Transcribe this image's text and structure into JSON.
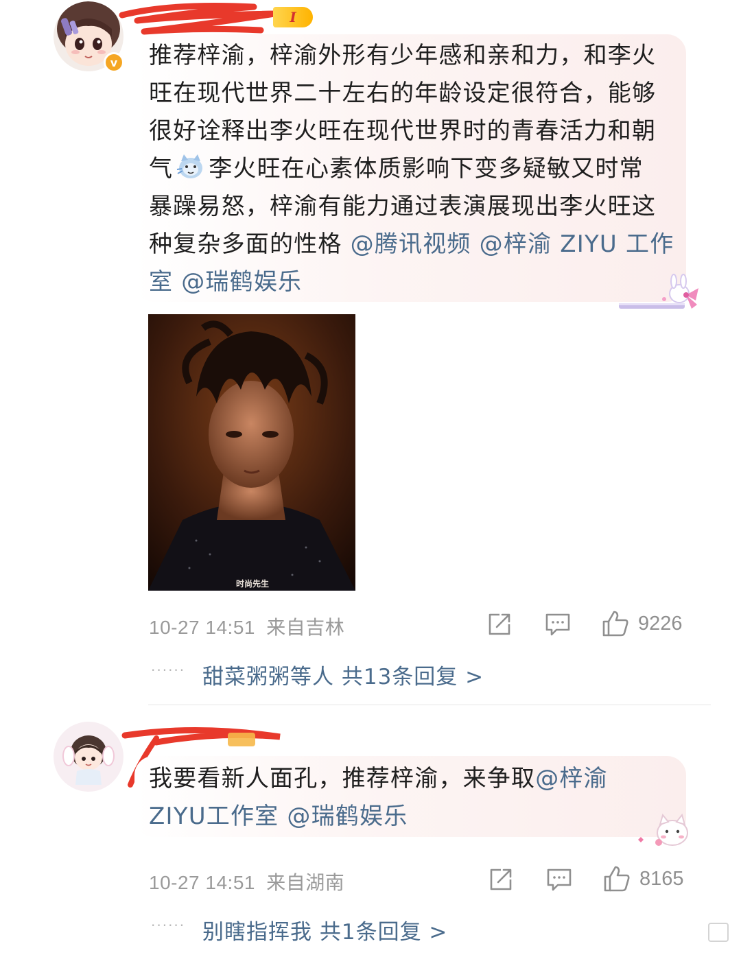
{
  "comments": [
    {
      "text_parts": [
        "推荐梓渝，梓渝外形有少年感和亲和力，和李火",
        "旺在现代世界二十左右的年龄设定很符合，能够",
        "很好诠释出李火旺在现代世界时的青春活力和朝",
        "气",
        "李火旺在心素体质影响下变多疑敏又时常",
        "暴躁易怒，梓渝有能力通过表演展现出李火旺这",
        "种复杂多面的性格"
      ],
      "mentions": [
        "@腾讯视频",
        "@梓渝 ZIYU 工作",
        "室",
        "@瑞鹤娱乐"
      ],
      "level_badge": "I",
      "verified_badge": "v",
      "photo_caption": "时尚先生",
      "time": "10-27 14:51",
      "location": "来自吉林",
      "likes": "9226",
      "replies": "甜菜粥粥等人  共13条回复 >"
    },
    {
      "text_parts": [
        "我要看新人面孔，推荐梓渝，来争取"
      ],
      "mentions": [
        "@梓渝",
        "ZIYU工作室",
        "@瑞鹤娱乐"
      ],
      "time": "10-27 14:51",
      "location": "来自湖南",
      "likes": "8165",
      "replies": "别瞎指挥我  共1条回复 >"
    }
  ],
  "icons": {
    "share": "share-icon",
    "comment": "comment-icon",
    "like": "like-icon"
  },
  "colors": {
    "mention": "#4a6b8c",
    "text": "#1f1f1f",
    "meta": "#9a9a9a",
    "redaction": "#e8392b"
  }
}
